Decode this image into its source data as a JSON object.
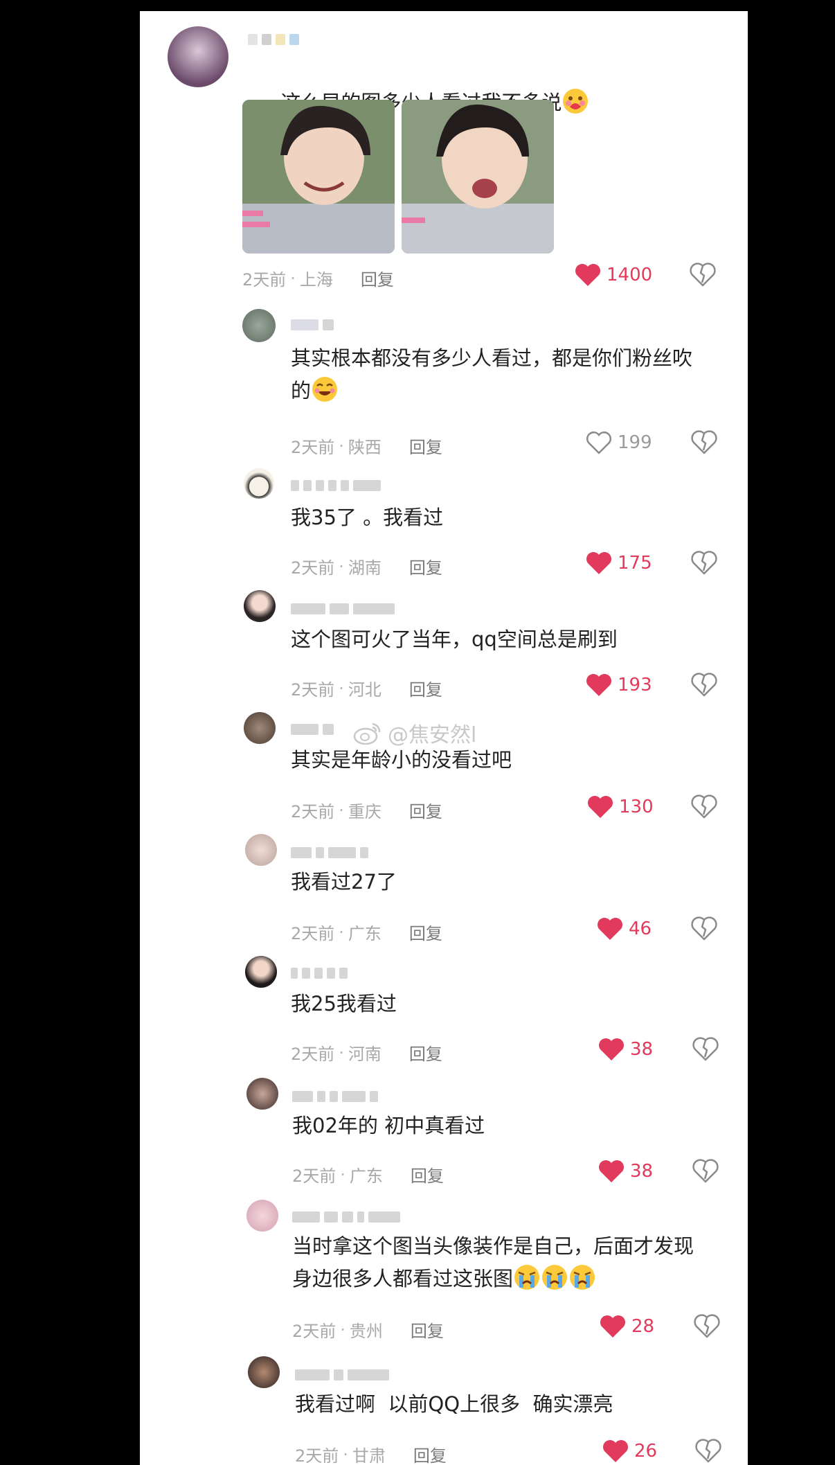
{
  "colors": {
    "like_active": "#e23a5c",
    "muted": "#9a9a9a",
    "text": "#222222"
  },
  "watermark": "@焦安然l",
  "top_comment": {
    "text": "这么早的图多少人看过我不多说",
    "time": "2天前",
    "location": "上海",
    "reply": "回复",
    "likes": "1400",
    "liked": true
  },
  "replies": [
    {
      "text": "其实根本都没有多少人看过，都是你们粉丝吹\n的",
      "time": "2天前",
      "location": "陕西",
      "reply": "回复",
      "likes": "199",
      "liked": false
    },
    {
      "text": "我35了 。我看过",
      "time": "2天前",
      "location": "湖南",
      "reply": "回复",
      "likes": "175",
      "liked": true
    },
    {
      "text": "这个图可火了当年，qq空间总是刷到",
      "time": "2天前",
      "location": "河北",
      "reply": "回复",
      "likes": "193",
      "liked": true
    },
    {
      "text": "其实是年龄小的没看过吧",
      "time": "2天前",
      "location": "重庆",
      "reply": "回复",
      "likes": "130",
      "liked": true
    },
    {
      "text": "我看过27了",
      "time": "2天前",
      "location": "广东",
      "reply": "回复",
      "likes": "46",
      "liked": true
    },
    {
      "text": "我25我看过",
      "time": "2天前",
      "location": "河南",
      "reply": "回复",
      "likes": "38",
      "liked": true
    },
    {
      "text": "我02年的 初中真看过",
      "time": "2天前",
      "location": "广东",
      "reply": "回复",
      "likes": "38",
      "liked": true
    },
    {
      "text": "当时拿这个图当头像装作是自己，后面才发现\n身边很多人都看过这张图",
      "time": "2天前",
      "location": "贵州",
      "reply": "回复",
      "likes": "28",
      "liked": true
    },
    {
      "text": "我看过啊  以前QQ上很多  确实漂亮",
      "time": "2天前",
      "location": "甘肃",
      "reply": "回复",
      "likes": "26",
      "liked": true
    }
  ]
}
